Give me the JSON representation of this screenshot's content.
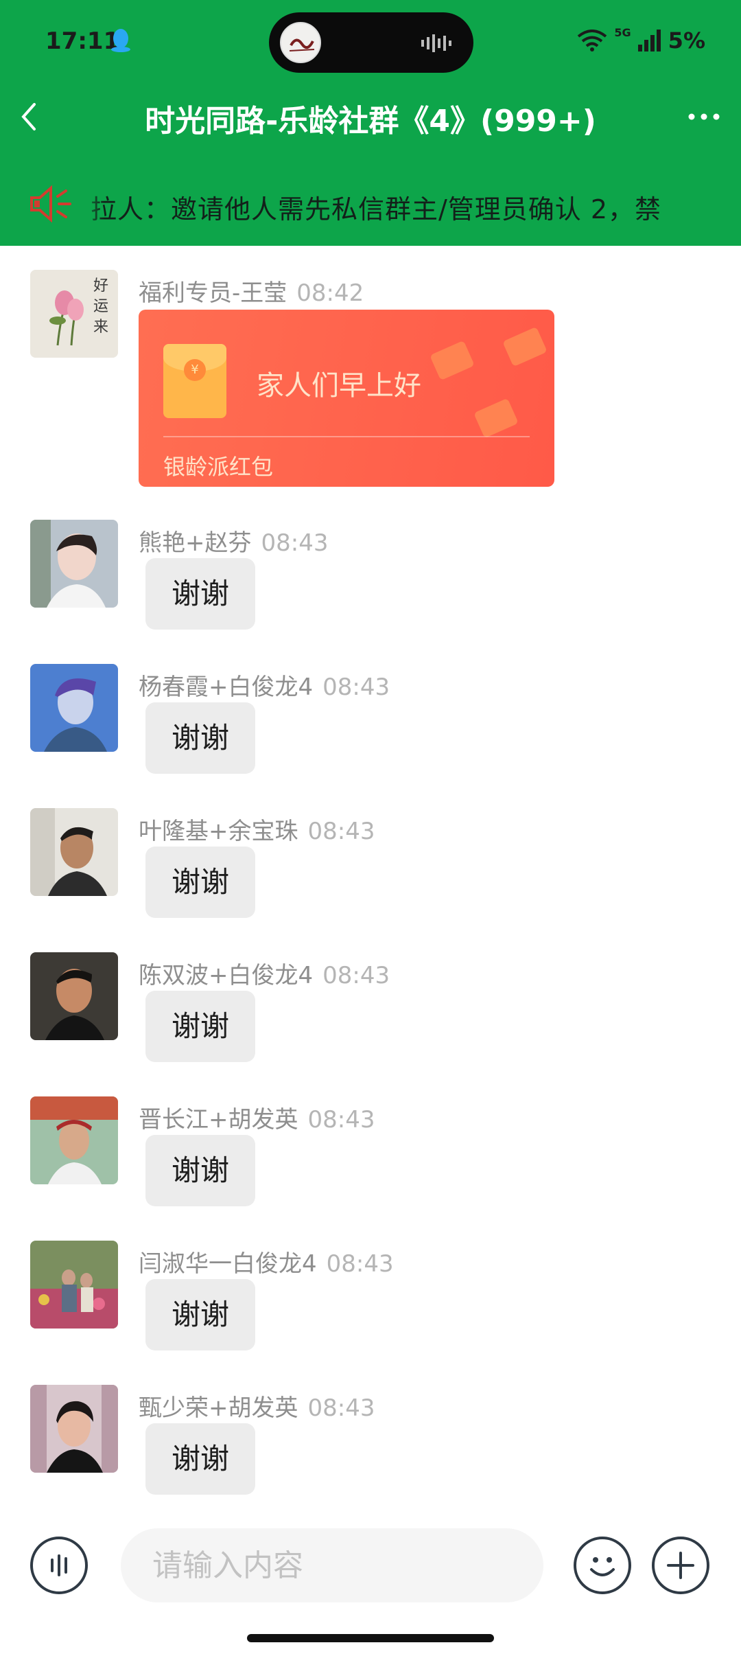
{
  "status_bar": {
    "time": "17:11",
    "network": "5G",
    "battery": "5%"
  },
  "nav": {
    "title": "时光同路-乐龄社群《4》(999+)"
  },
  "notice": {
    "text": "拉人：邀请他人需先私信群主/管理员确认 2，禁"
  },
  "messages": [
    {
      "sender": "福利专员-王莹",
      "time": "08:42",
      "type": "red_packet",
      "greeting": "家人们早上好",
      "packet_label": "银龄派红包"
    },
    {
      "sender": "熊艳+赵芬",
      "time": "08:43",
      "text": "谢谢"
    },
    {
      "sender": "杨春霞+白俊龙4",
      "time": "08:43",
      "text": "谢谢"
    },
    {
      "sender": "叶隆基+余宝珠",
      "time": "08:43",
      "text": "谢谢"
    },
    {
      "sender": "陈双波+白俊龙4",
      "time": "08:43",
      "text": "谢谢"
    },
    {
      "sender": "晋长江+胡发英",
      "time": "08:43",
      "text": "谢谢"
    },
    {
      "sender": "闫淑华一白俊龙4",
      "time": "08:43",
      "text": "谢谢"
    },
    {
      "sender": "甄少荣+胡发英",
      "time": "08:43",
      "text": "谢谢"
    }
  ],
  "input": {
    "placeholder": "请输入内容"
  },
  "colors": {
    "header": "#0da54a",
    "red_packet": "#ff6450",
    "bubble": "#ececec"
  }
}
